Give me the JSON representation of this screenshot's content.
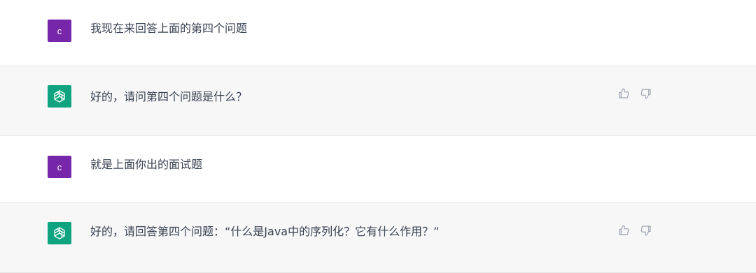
{
  "conversation": {
    "messages": [
      {
        "role": "user",
        "avatar_letter": "c",
        "text": "我现在来回答上面的第四个问题"
      },
      {
        "role": "assistant",
        "text": "好的，请问第四个问题是什么？"
      },
      {
        "role": "user",
        "avatar_letter": "c",
        "text": "就是上面你出的面试题"
      },
      {
        "role": "assistant",
        "text": "好的，请回答第四个问题：“什么是Java中的序列化？它有什么作用？”"
      }
    ]
  },
  "icons": {
    "assistant_avatar": "openai-logo-icon",
    "like": "thumbs-up-icon",
    "dislike": "thumbs-down-icon"
  },
  "colors": {
    "user_avatar_bg": "#7626a8",
    "assistant_avatar_bg": "#10a37f",
    "assistant_row_bg": "#f7f7f8"
  }
}
